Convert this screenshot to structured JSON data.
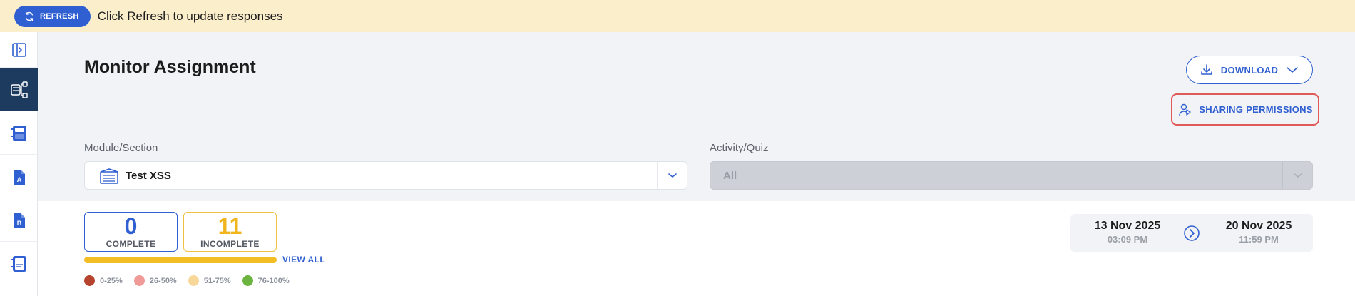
{
  "banner": {
    "refresh_label": "REFRESH",
    "message": "Click Refresh to update responses"
  },
  "sidebar": {
    "items": [
      {
        "icon": "expand-sidebar-icon",
        "active": false
      },
      {
        "icon": "assignment-monitor-icon",
        "active": true
      },
      {
        "icon": "notebook-icon",
        "active": false
      },
      {
        "icon": "book-a-icon",
        "active": false
      },
      {
        "icon": "book-b-icon",
        "active": false
      },
      {
        "icon": "notes-icon",
        "active": false
      }
    ]
  },
  "page": {
    "title": "Monitor Assignment"
  },
  "actions": {
    "download_label": "DOWNLOAD",
    "sharing_label": "SHARING PERMISSIONS"
  },
  "filters": {
    "module_label": "Module/Section",
    "module_value": "Test XSS",
    "activity_label": "Activity/Quiz",
    "activity_value": "All"
  },
  "stats": {
    "complete_value": "0",
    "complete_label": "COMPLETE",
    "incomplete_value": "11",
    "incomplete_label": "INCOMPLETE",
    "view_all_label": "VIEW ALL",
    "complete_fraction": 0
  },
  "legend": [
    {
      "label": "0-25%",
      "color": "#b5432e"
    },
    {
      "label": "26-50%",
      "color": "#ef9a96"
    },
    {
      "label": "51-75%",
      "color": "#f8d79a"
    },
    {
      "label": "76-100%",
      "color": "#6db33f"
    }
  ],
  "dates": {
    "start_date": "13 Nov 2025",
    "start_time": "03:09 PM",
    "end_date": "20 Nov 2025",
    "end_time": "11:59 PM"
  },
  "colors": {
    "accent": "#2f5fd0",
    "sidebar_active": "#1d3a5f",
    "banner_bg": "#fbeecb",
    "incomplete": "#f3bd24",
    "highlight_border": "#e05a5a"
  }
}
